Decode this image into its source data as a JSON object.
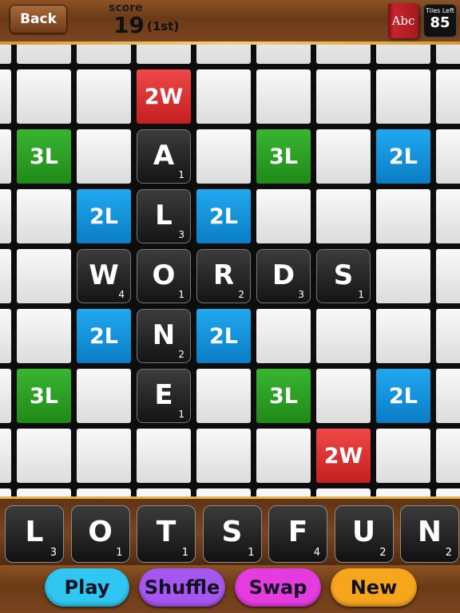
{
  "header": {
    "back_label": "Back",
    "score_label": "score",
    "score_value": "19",
    "score_rank": "(1st)",
    "dictionary_label": "Abc",
    "tiles_left_label": "Tiles Left",
    "tiles_left_count": "85"
  },
  "board": {
    "premium_squares": [
      {
        "col": 2,
        "row": 0,
        "label": "2W",
        "kind": "dw"
      },
      {
        "col": 0,
        "row": 1,
        "label": "3L",
        "kind": "tl"
      },
      {
        "col": 4,
        "row": 1,
        "label": "3L",
        "kind": "tl"
      },
      {
        "col": 6,
        "row": 1,
        "label": "2L",
        "kind": "dl"
      },
      {
        "col": 1,
        "row": 2,
        "label": "2L",
        "kind": "dl"
      },
      {
        "col": 3,
        "row": 2,
        "label": "2L",
        "kind": "dl"
      },
      {
        "col": 1,
        "row": 4,
        "label": "2L",
        "kind": "dl"
      },
      {
        "col": 3,
        "row": 4,
        "label": "2L",
        "kind": "dl"
      },
      {
        "col": 0,
        "row": 5,
        "label": "3L",
        "kind": "tl"
      },
      {
        "col": 4,
        "row": 5,
        "label": "3L",
        "kind": "tl"
      },
      {
        "col": 6,
        "row": 5,
        "label": "2L",
        "kind": "dl"
      },
      {
        "col": 5,
        "row": 6,
        "label": "2W",
        "kind": "dw"
      }
    ],
    "placed_tiles": [
      {
        "col": 2,
        "row": 1,
        "letter": "A",
        "points": "1"
      },
      {
        "col": 2,
        "row": 2,
        "letter": "L",
        "points": "3"
      },
      {
        "col": 1,
        "row": 3,
        "letter": "W",
        "points": "4"
      },
      {
        "col": 2,
        "row": 3,
        "letter": "O",
        "points": "1"
      },
      {
        "col": 3,
        "row": 3,
        "letter": "R",
        "points": "2"
      },
      {
        "col": 4,
        "row": 3,
        "letter": "D",
        "points": "3"
      },
      {
        "col": 5,
        "row": 3,
        "letter": "S",
        "points": "1"
      },
      {
        "col": 2,
        "row": 4,
        "letter": "N",
        "points": "2"
      },
      {
        "col": 2,
        "row": 5,
        "letter": "E",
        "points": "1"
      }
    ]
  },
  "rack": [
    {
      "letter": "L",
      "points": "3"
    },
    {
      "letter": "O",
      "points": "1"
    },
    {
      "letter": "T",
      "points": "1"
    },
    {
      "letter": "S",
      "points": "1"
    },
    {
      "letter": "F",
      "points": "4"
    },
    {
      "letter": "U",
      "points": "2"
    },
    {
      "letter": "N",
      "points": "2"
    }
  ],
  "buttons": {
    "play": "Play",
    "shuffle": "Shuffle",
    "swap": "Swap",
    "new": "New"
  },
  "colors": {
    "play": "#2fc6f2",
    "shuffle": "#a657ef",
    "swap": "#e53ce0",
    "new": "#f6a51d"
  }
}
